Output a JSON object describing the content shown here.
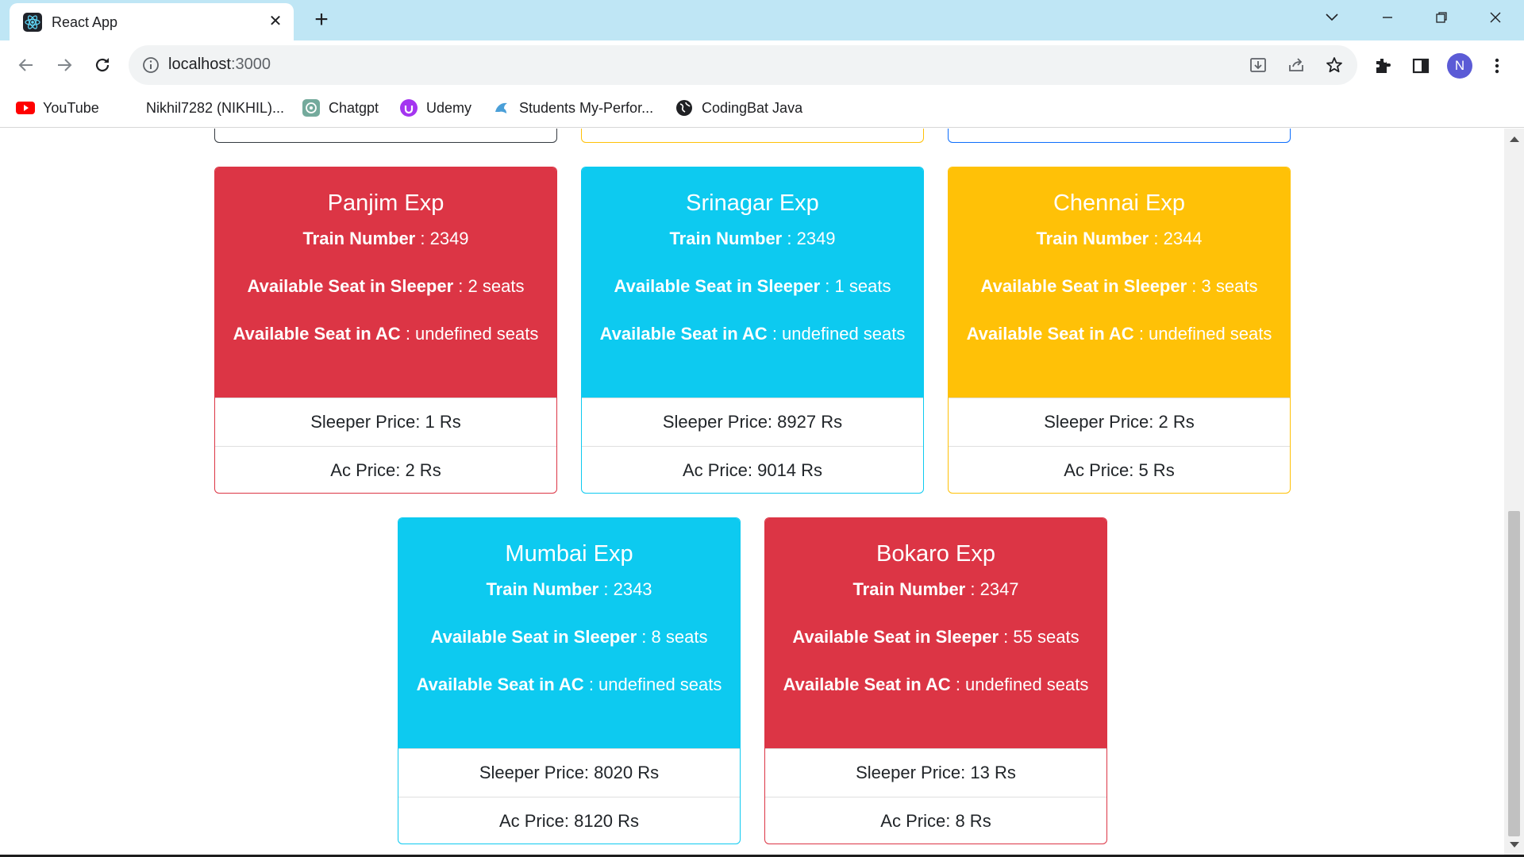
{
  "browser": {
    "tab_title": "React App",
    "tab_close": "✕",
    "new_tab": "+",
    "url_host": "localhost",
    "url_port": ":3000",
    "profile_initial": "N"
  },
  "bookmarks": [
    {
      "label": "YouTube",
      "icon": "youtube-icon"
    },
    {
      "label": "Nikhil7282 (NIKHIL)...",
      "icon": "github-icon"
    },
    {
      "label": "Chatgpt",
      "icon": "chatgpt-icon"
    },
    {
      "label": "Udemy",
      "icon": "udemy-icon"
    },
    {
      "label": "Students My-Perfor...",
      "icon": "dolphin-icon"
    },
    {
      "label": "CodingBat Java",
      "icon": "globe-icon"
    }
  ],
  "labels": {
    "train_number": "Train Number",
    "sleeper_seat": "Available Seat in Sleeper",
    "ac_seat": "Available Seat in AC",
    "sleeper_price": "Sleeper Price:",
    "ac_price": "Ac Price:"
  },
  "trains": [
    {
      "name": "Panjim Exp",
      "number": "2349",
      "sleeper_seats": "2 seats",
      "ac_seats": "undefined seats",
      "sleeper_price": "1 Rs",
      "ac_price": "2 Rs",
      "color": "#dc3545"
    },
    {
      "name": "Srinagar Exp",
      "number": "2349",
      "sleeper_seats": "1 seats",
      "ac_seats": "undefined seats",
      "sleeper_price": "8927 Rs",
      "ac_price": "9014 Rs",
      "color": "#0dcaf0"
    },
    {
      "name": "Chennai Exp",
      "number": "2344",
      "sleeper_seats": "3 seats",
      "ac_seats": "undefined seats",
      "sleeper_price": "2 Rs",
      "ac_price": "5 Rs",
      "color": "#ffc107"
    },
    {
      "name": "Mumbai Exp",
      "number": "2343",
      "sleeper_seats": "8 seats",
      "ac_seats": "undefined seats",
      "sleeper_price": "8020 Rs",
      "ac_price": "8120 Rs",
      "color": "#0dcaf0"
    },
    {
      "name": "Bokaro Exp",
      "number": "2347",
      "sleeper_seats": "55 seats",
      "ac_seats": "undefined seats",
      "sleeper_price": "13 Rs",
      "ac_price": "8 Rs",
      "color": "#dc3545"
    }
  ],
  "partial_card_colors": [
    "#343a40",
    "#ffc107",
    "#0d6efd"
  ]
}
